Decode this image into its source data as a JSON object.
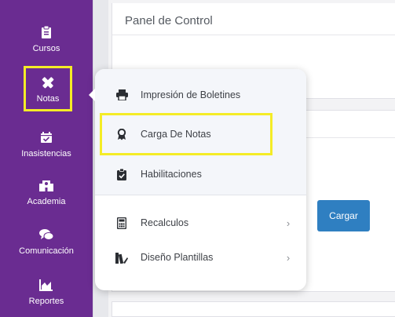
{
  "colors": {
    "sidebar": "#6a2c91",
    "accent_button": "#2f7fc1",
    "highlight": "#f4ec26"
  },
  "sidebar": {
    "items": [
      {
        "label": "Cursos",
        "icon": "clipboard-icon"
      },
      {
        "label": "Notas",
        "icon": "pencil-ruler-icon"
      },
      {
        "label": "Inasistencias",
        "icon": "calendar-check-icon"
      },
      {
        "label": "Academia",
        "icon": "school-building-icon"
      },
      {
        "label": "Comunicación",
        "icon": "chat-bubbles-icon"
      },
      {
        "label": "Reportes",
        "icon": "area-chart-icon"
      }
    ]
  },
  "main": {
    "title": "Panel de Control",
    "button_label": "Cargar"
  },
  "dropdown": {
    "items": [
      {
        "label": "Impresión de Boletines",
        "icon": "printer-icon"
      },
      {
        "label": "Carga De Notas",
        "icon": "award-ribbon-icon"
      },
      {
        "label": "Habilitaciones",
        "icon": "clipboard-check-icon"
      },
      {
        "label": "Recalculos",
        "icon": "calculator-icon",
        "chevron": "›"
      },
      {
        "label": "Diseño Plantillas",
        "icon": "paint-swatch-icon",
        "chevron": "›"
      }
    ]
  }
}
